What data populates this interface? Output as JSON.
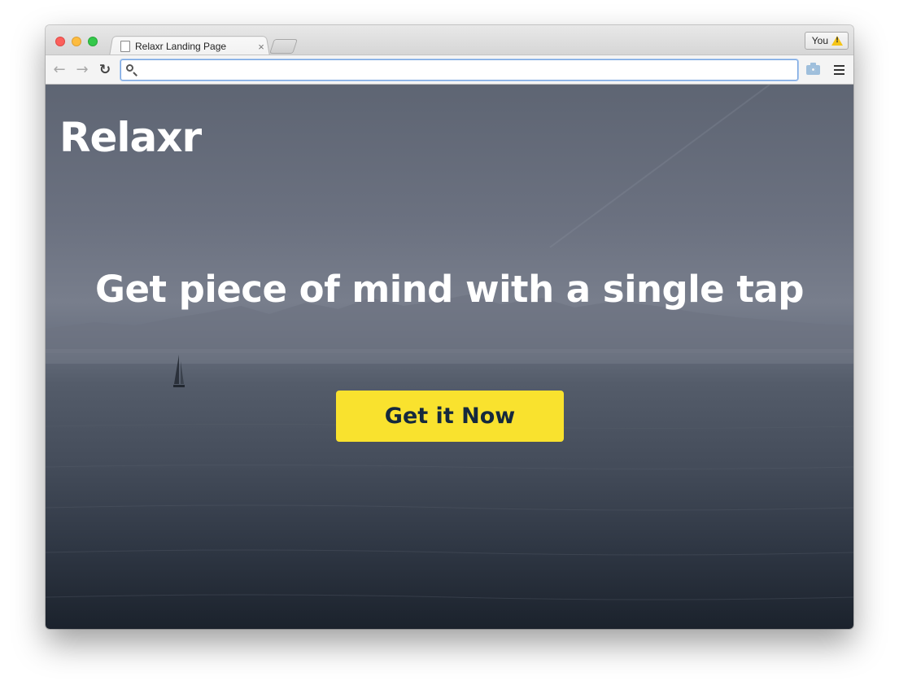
{
  "browser": {
    "tab": {
      "title": "Relaxr Landing Page",
      "close_glyph": "×"
    },
    "profile": {
      "label": "You"
    },
    "omnibox": {
      "value": ""
    },
    "nav": {
      "back_glyph": "←",
      "forward_glyph": "→",
      "reload_glyph": "↻"
    },
    "icons": {
      "warning": "warning-icon",
      "camera": "camera-icon",
      "menu": "menu-icon",
      "search": "search-icon"
    }
  },
  "page": {
    "brand": "Relaxr",
    "headline": "Get piece of mind with a single tap",
    "cta_label": "Get it Now"
  },
  "colors": {
    "cta_background": "#f9e22e",
    "cta_text": "#15293d",
    "text": "#ffffff"
  }
}
